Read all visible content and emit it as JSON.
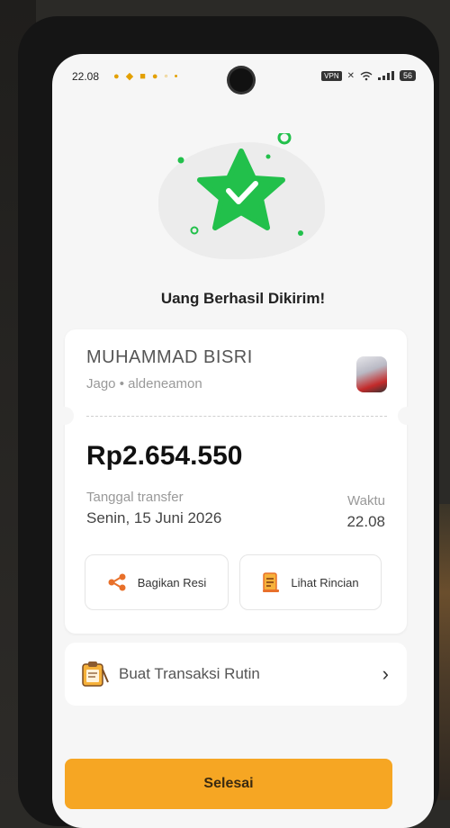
{
  "status_bar": {
    "time": "22.08",
    "vpn_label": "VPN",
    "battery_label": "56"
  },
  "success": {
    "title": "Uang Berhasil Dikirim!",
    "accent_color": "#22c04b"
  },
  "recipient": {
    "name": "MUHAMMAD BISRI",
    "bank_and_handle": "Jago • aldeneamon"
  },
  "transfer": {
    "amount": "Rp2.654.550",
    "date_label": "Tanggal transfer",
    "date_value": "Senin, 15 Juni 2026",
    "time_label": "Waktu",
    "time_value": "22.08"
  },
  "actions": {
    "share_label": "Bagikan Resi",
    "detail_label": "Lihat Rincian"
  },
  "routine": {
    "label": "Buat Transaksi Rutin",
    "chevron": "›"
  },
  "done_button": {
    "label": "Selesai",
    "color": "#f6a623"
  },
  "icons": {
    "success": "star-check-icon",
    "share": "share-icon",
    "detail": "receipt-icon",
    "routine": "clipboard-icon",
    "chevron": "chevron-right-icon"
  }
}
